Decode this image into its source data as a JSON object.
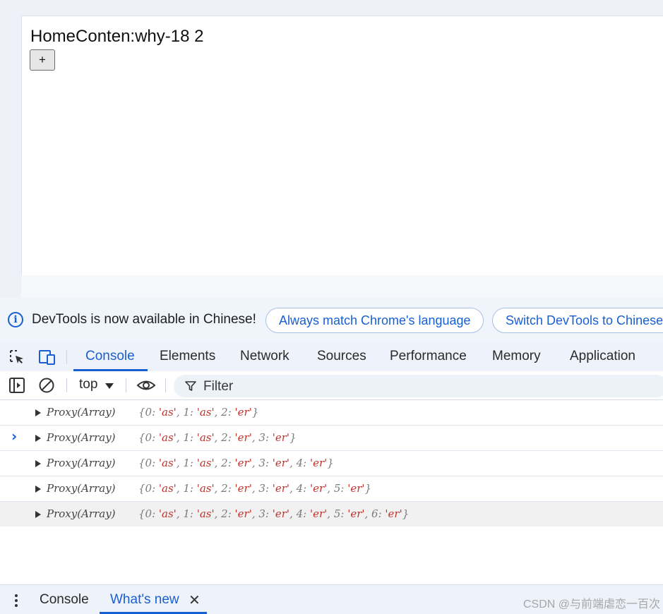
{
  "page": {
    "title": "HomeConten:why-18 2",
    "plus_button": "+"
  },
  "infobar": {
    "message": "DevTools is now available in Chinese!",
    "match_language_button": "Always match Chrome's language",
    "switch_button": "Switch DevTools to Chinese"
  },
  "tabs": {
    "console": "Console",
    "elements": "Elements",
    "network": "Network",
    "sources": "Sources",
    "performance": "Performance",
    "memory": "Memory",
    "application": "Application"
  },
  "toolbar": {
    "context": "top",
    "filter_placeholder": "Filter"
  },
  "console": {
    "entries": [
      {
        "type": "Proxy(Array)",
        "items": [
          [
            "0",
            "as"
          ],
          [
            "1",
            "as"
          ],
          [
            "2",
            "er"
          ]
        ]
      },
      {
        "type": "Proxy(Array)",
        "items": [
          [
            "0",
            "as"
          ],
          [
            "1",
            "as"
          ],
          [
            "2",
            "er"
          ],
          [
            "3",
            "er"
          ]
        ]
      },
      {
        "type": "Proxy(Array)",
        "items": [
          [
            "0",
            "as"
          ],
          [
            "1",
            "as"
          ],
          [
            "2",
            "er"
          ],
          [
            "3",
            "er"
          ],
          [
            "4",
            "er"
          ]
        ]
      },
      {
        "type": "Proxy(Array)",
        "items": [
          [
            "0",
            "as"
          ],
          [
            "1",
            "as"
          ],
          [
            "2",
            "er"
          ],
          [
            "3",
            "er"
          ],
          [
            "4",
            "er"
          ],
          [
            "5",
            "er"
          ]
        ]
      },
      {
        "type": "Proxy(Array)",
        "items": [
          [
            "0",
            "as"
          ],
          [
            "1",
            "as"
          ],
          [
            "2",
            "er"
          ],
          [
            "3",
            "er"
          ],
          [
            "4",
            "er"
          ],
          [
            "5",
            "er"
          ],
          [
            "6",
            "er"
          ]
        ]
      }
    ],
    "prompt": "›"
  },
  "drawer": {
    "tab_console": "Console",
    "tab_whats_new": "What's new",
    "close": "✕"
  },
  "watermark": "CSDN @与前端虐恋一百次",
  "colors": {
    "accent": "#1a5fd0",
    "string_value": "#c5312b"
  },
  "icons": {
    "info": "info-icon",
    "inspect": "inspect-element-icon",
    "device": "device-toggle-icon",
    "sidebar": "sidebar-toggle-icon",
    "clear": "clear-console-icon",
    "eye": "live-expression-icon",
    "filter": "filter-icon",
    "menu": "kebab-menu-icon"
  }
}
